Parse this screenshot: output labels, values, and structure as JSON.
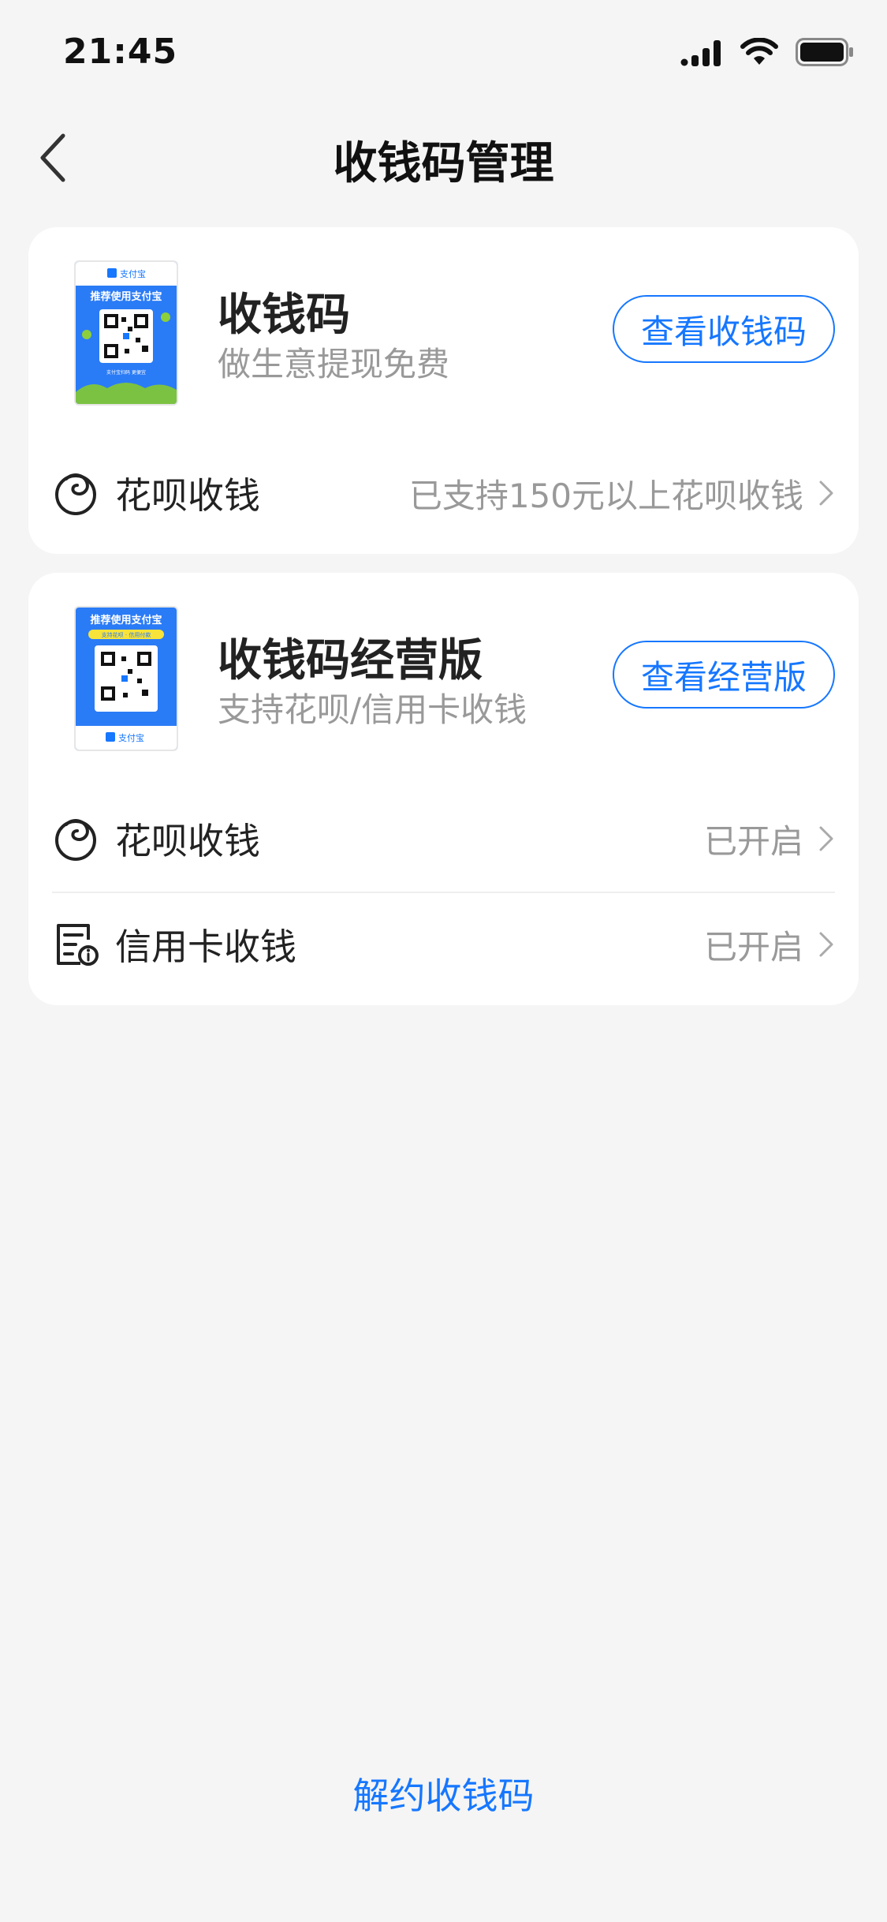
{
  "status_bar": {
    "time": "21:45"
  },
  "nav": {
    "title": "收钱码管理"
  },
  "card1": {
    "thumb": {
      "brand": "支付宝",
      "headline": "推荐使用支付宝",
      "footer": "支付宝扫码 更便宜"
    },
    "title": "收钱码",
    "subtitle": "做生意提现免费",
    "button": "查看收钱码",
    "rows": [
      {
        "label": "花呗收钱",
        "value": "已支持150元以上花呗收钱"
      }
    ]
  },
  "card2": {
    "thumb": {
      "headline": "推荐使用支付宝",
      "badge": "支持花呗 · 信用付款",
      "brand": "支付宝"
    },
    "title": "收钱码经营版",
    "subtitle": "支持花呗/信用卡收钱",
    "button": "查看经营版",
    "rows": [
      {
        "label": "花呗收钱",
        "value": "已开启"
      },
      {
        "label": "信用卡收钱",
        "value": "已开启"
      }
    ]
  },
  "footer": {
    "terminate_label": "解约收钱码"
  },
  "colors": {
    "accent": "#1677ff",
    "background": "#f5f5f5",
    "card": "#ffffff"
  }
}
